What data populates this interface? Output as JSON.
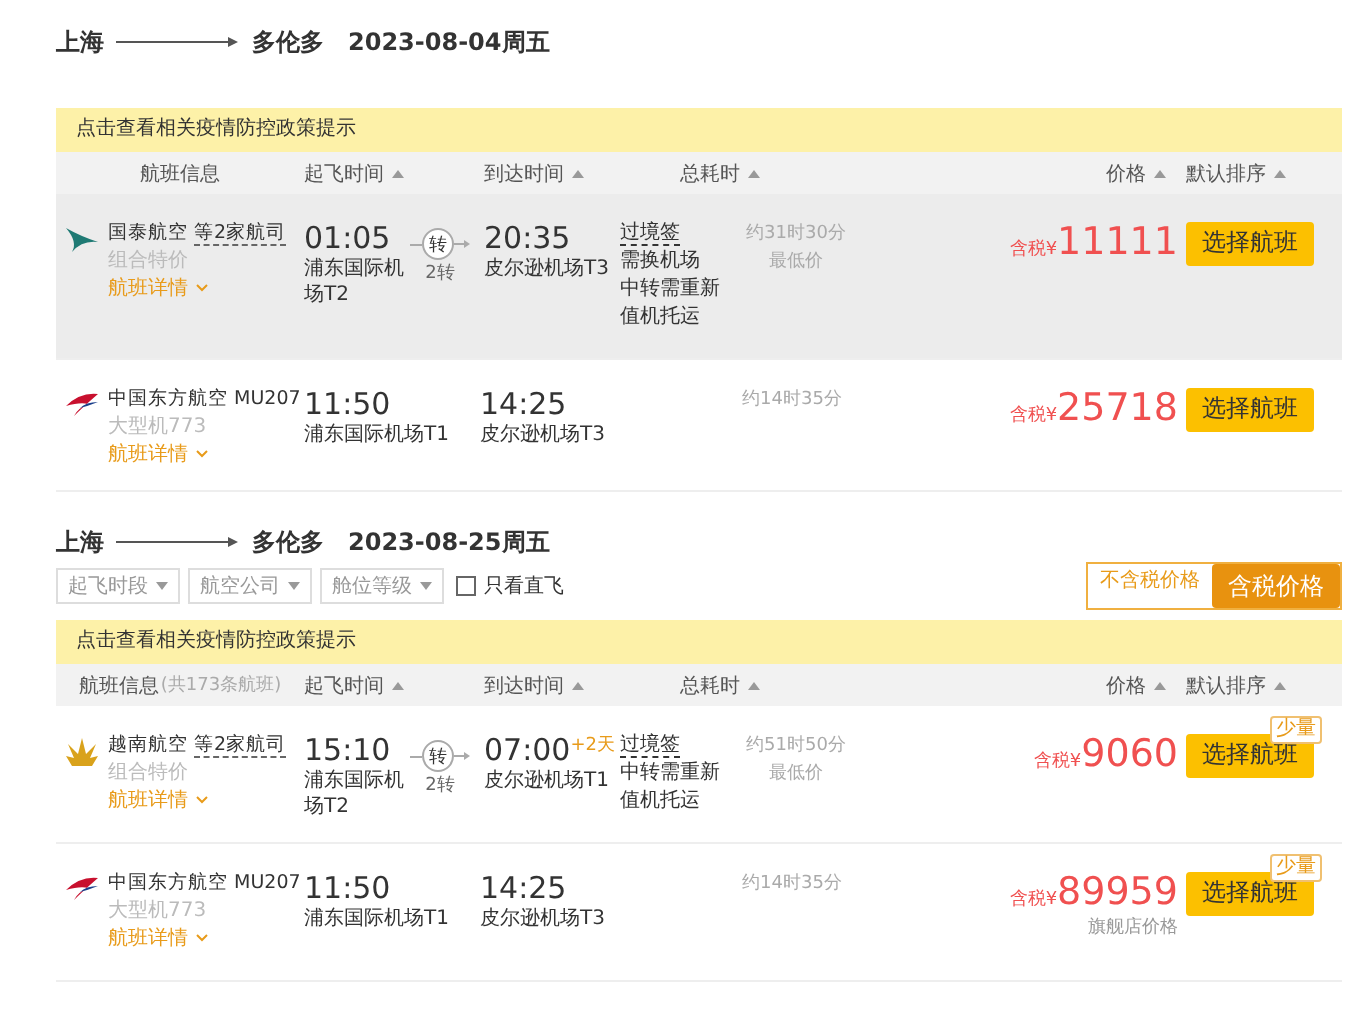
{
  "sections": [
    {
      "origin": "上海",
      "destination": "多伦多",
      "date": "2023-08-04周五",
      "notice": "点击查看相关疫情防控政策提示",
      "columns": [
        {
          "label": "航班信息",
          "sortable": false
        },
        {
          "label": "起飞时间",
          "sortable": true
        },
        {
          "label": "到达时间",
          "sortable": true
        },
        {
          "label": "总耗时",
          "sortable": true
        },
        {
          "label": "价格",
          "sortable": true
        },
        {
          "label": "默认排序",
          "sortable": true
        }
      ],
      "flights": [
        {
          "kind": "cathay",
          "highlighted": true,
          "airline": "国泰航空",
          "partners": "等2家航司",
          "sub": "组合特价",
          "details": "航班详情",
          "dep_time": "01:05",
          "dep_airport": "浦东国际机场T2",
          "transfer": "转",
          "transfer_count": "2转",
          "arr_time": "20:35",
          "arr_airport": "皮尔逊机场T3",
          "visa": "过境签",
          "notes": [
            "需换机场",
            "中转需重新值机托运"
          ],
          "duration": "约31时30分",
          "tag": "最低价",
          "price_prefix": "含税¥",
          "price": "11111",
          "button": "选择航班"
        },
        {
          "kind": "eastern",
          "highlighted": false,
          "airline": "中国东方航空",
          "partners": "MU207",
          "sub": "大型机773",
          "details": "航班详情",
          "dep_time": "11:50",
          "dep_airport": "浦东国际机场T1",
          "arr_time": "14:25",
          "arr_airport": "皮尔逊机场T3",
          "duration": "约14时35分",
          "price_prefix": "含税¥",
          "price": "25718",
          "button": "选择航班"
        }
      ]
    },
    {
      "origin": "上海",
      "destination": "多伦多",
      "date": "2023-08-25周五",
      "filters": [
        {
          "label": "起飞时段"
        },
        {
          "label": "航空公司"
        },
        {
          "label": "舱位等级"
        }
      ],
      "direct_only": {
        "label": "只看直飞",
        "checked": false
      },
      "price_modes": [
        {
          "label": "不含税价格",
          "selected": false
        },
        {
          "label": "含税价格",
          "selected": true
        }
      ],
      "notice": "点击查看相关疫情防控政策提示",
      "columns": [
        {
          "label": "航班信息",
          "count": "(共173条航班)",
          "sortable": false
        },
        {
          "label": "起飞时间",
          "sortable": true
        },
        {
          "label": "到达时间",
          "sortable": true
        },
        {
          "label": "总耗时",
          "sortable": true
        },
        {
          "label": "价格",
          "sortable": true
        },
        {
          "label": "默认排序",
          "sortable": true
        }
      ],
      "flights": [
        {
          "kind": "vietnam",
          "highlighted": false,
          "airline": "越南航空",
          "partners": "等2家航司",
          "sub": "组合特价",
          "details": "航班详情",
          "dep_time": "15:10",
          "dep_airport": "浦东国际机场T2",
          "transfer": "转",
          "transfer_count": "2转",
          "arr_time": "07:00",
          "day_offset": "+2天",
          "arr_airport": "皮尔逊机场T1",
          "visa": "过境签",
          "notes": [
            "中转需重新值机托运"
          ],
          "duration": "约51时50分",
          "tag": "最低价",
          "price_prefix": "含税¥",
          "price": "9060",
          "badge": "少量",
          "button": "选择航班"
        },
        {
          "kind": "eastern",
          "highlighted": false,
          "airline": "中国东方航空",
          "partners": "MU207",
          "sub": "大型机773",
          "details": "航班详情",
          "dep_time": "11:50",
          "dep_airport": "浦东国际机场T1",
          "arr_time": "14:25",
          "arr_airport": "皮尔逊机场T3",
          "duration": "约14时35分",
          "price_prefix": "含税¥",
          "price": "89959",
          "price_note": "旗舰店价格",
          "badge": "少量",
          "button": "选择航班"
        }
      ]
    }
  ]
}
